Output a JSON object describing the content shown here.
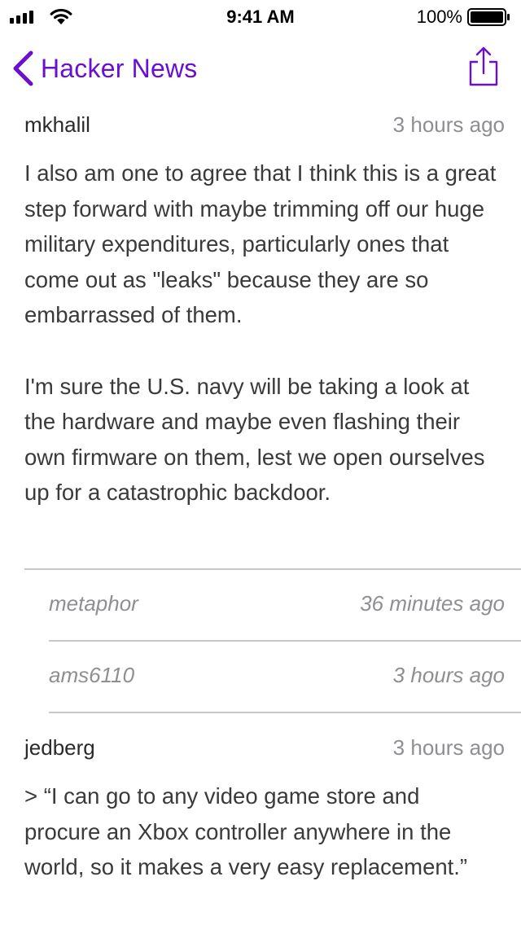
{
  "status_bar": {
    "time": "9:41 AM",
    "battery_percent": "100%",
    "signal_icon": "cellular-signal-icon",
    "wifi_icon": "wifi-icon",
    "battery_icon": "battery-full-icon"
  },
  "nav": {
    "back_label": "Hacker News",
    "back_icon": "chevron-left-icon",
    "share_icon": "share-icon",
    "accent_color": "#6a0fd1"
  },
  "comments": [
    {
      "author": "mkhalil",
      "time": "3 hours ago",
      "paragraphs": [
        "I also am one to agree that I think this is a great step forward with maybe trimming off our huge military expenditures, particularly ones that come out as \"leaks\" because they are so embarrassed of them.",
        "I'm sure the U.S. navy will be taking a look at the hardware and maybe even flashing their own firmware on them, lest we open ourselves up for a catastrophic backdoor."
      ]
    },
    {
      "author": "jedberg",
      "time": "3 hours ago",
      "paragraphs": [
        "> “I can go to any video game store and procure an Xbox controller anywhere in the world, so it makes a very easy replacement.”"
      ]
    }
  ],
  "collapsed_replies": [
    {
      "author": "metaphor",
      "time": "36 minutes ago"
    },
    {
      "author": "ams6110",
      "time": "3 hours ago"
    }
  ]
}
